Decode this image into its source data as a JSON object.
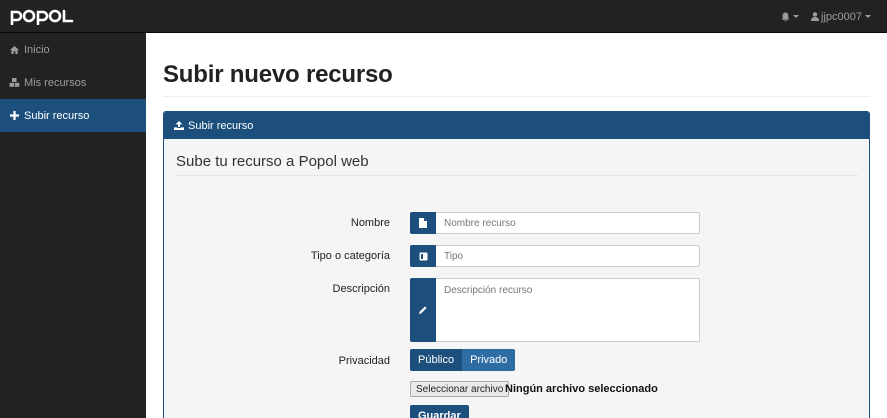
{
  "app": {
    "logo_text": "popol"
  },
  "navbar": {
    "notifications_icon": "bell-icon",
    "user": {
      "icon": "user-icon",
      "name": "jjpc0007"
    }
  },
  "sidebar": {
    "items": [
      {
        "label": "Inicio",
        "icon": "home-icon",
        "active": false
      },
      {
        "label": "Mis recursos",
        "icon": "cubes-icon",
        "active": false
      },
      {
        "label": "Subir recurso",
        "icon": "plus-icon",
        "active": true
      }
    ]
  },
  "page": {
    "title": "Subir nuevo recurso"
  },
  "panel": {
    "heading": "Subir recurso",
    "heading_icon": "upload-icon",
    "legend": "Sube tu recurso a Popol web"
  },
  "form": {
    "nombre": {
      "label": "Nombre",
      "placeholder": "Nombre recurso",
      "icon": "file-icon"
    },
    "tipo": {
      "label": "Tipo o categoría",
      "placeholder": "Tipo",
      "icon": "book-icon"
    },
    "descripcion": {
      "label": "Descripción",
      "placeholder": "Descripción recurso",
      "icon": "pencil-icon"
    },
    "privacidad": {
      "label": "Privacidad",
      "options": [
        "Público",
        "Privado"
      ]
    },
    "file": {
      "button": "Seleccionar archivo",
      "status": "Ningún archivo seleccionado"
    },
    "submit": "Guardar"
  },
  "colors": {
    "primary": "#1d4f7d",
    "navbar": "#222222",
    "secondary": "#2e6da4"
  }
}
